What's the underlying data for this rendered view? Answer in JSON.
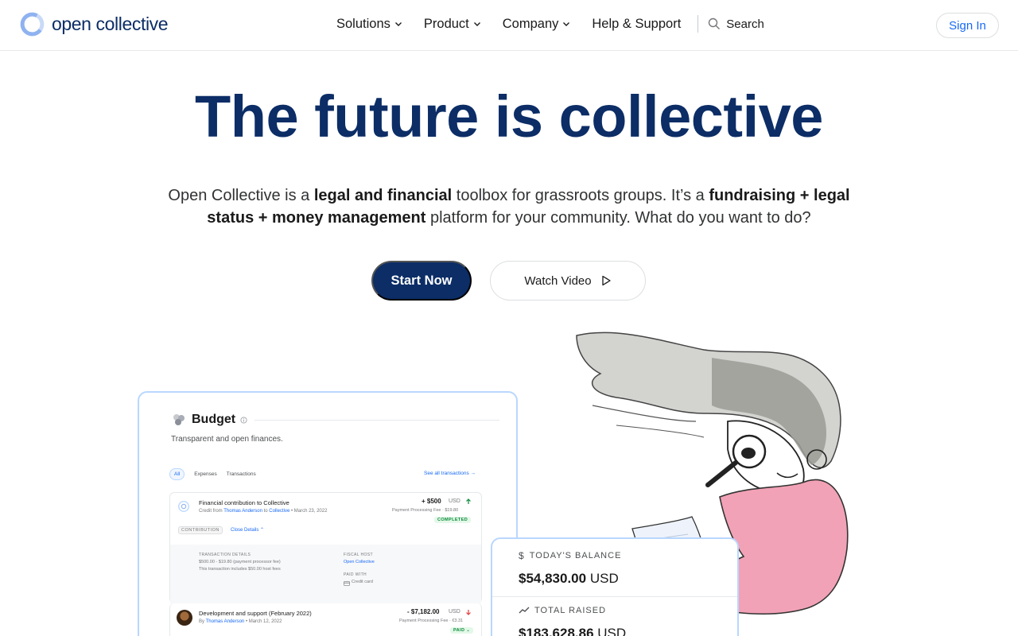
{
  "nav": {
    "logo_text": "open collective",
    "menu": [
      {
        "label": "Solutions",
        "has_dropdown": true
      },
      {
        "label": "Product",
        "has_dropdown": true
      },
      {
        "label": "Company",
        "has_dropdown": true
      },
      {
        "label": "Help & Support",
        "has_dropdown": false
      }
    ],
    "search_label": "Search",
    "signin_label": "Sign In"
  },
  "hero": {
    "title": "The future is collective",
    "desc": {
      "p1": "Open Collective is a ",
      "b1": "legal and financial",
      "p2": " toolbox for grassroots groups. It’s a ",
      "b2": "fundraising + legal status + money management",
      "p3": " platform for your community. What do you want to do?"
    },
    "start_label": "Start Now",
    "watch_label": "Watch Video"
  },
  "budget": {
    "title": "Budget",
    "subtitle": "Transparent and open finances.",
    "tabs": [
      "All",
      "Expenses",
      "Transactions"
    ],
    "see_all": "See all transactions →",
    "item1": {
      "title": "Financial contribution to Collective",
      "credit_prefix": "Credit from",
      "credit_from": "Thomas Anderson",
      "credit_to_word": "to",
      "credit_to": "Collective",
      "date": "• March 23, 2022",
      "amount": "+ $500",
      "currency": "USD",
      "fee": "Payment Processing Fee · $19.80",
      "status": "COMPLETED",
      "tag": "CONTRIBUTION",
      "close_details": "Close Details ⌃",
      "details_label": "TRANSACTION DETAILS",
      "details_line1": "$500.00 - $19.80 (payment processor fee)",
      "details_line2": "This transaction includes $50.00 host fees",
      "host_label": "FISCAL HOST",
      "host_value": "Open Collective",
      "paid_with_label": "PAID WITH",
      "paid_with_value": "Credit card"
    },
    "item2": {
      "title": "Development and support (February 2022)",
      "by_prefix": "By",
      "by": "Thomas Anderson",
      "date": "• March 12, 2022",
      "amount": "- $7,182.00",
      "currency": "USD",
      "fee": "Payment Processing Fee · €3.31",
      "status": "PAID ⌄"
    }
  },
  "balance": {
    "today_label": "TODAY'S BALANCE",
    "today_value": "$54,830.00",
    "today_currency": "USD",
    "raised_label": "TOTAL RAISED",
    "raised_value": "$183,628.86",
    "raised_currency": "USD"
  },
  "colors": {
    "brand_navy": "#0c2d66",
    "link_blue": "#1869f5",
    "card_border": "#b9d7ff",
    "illustration_pink": "#f2a2b6"
  }
}
